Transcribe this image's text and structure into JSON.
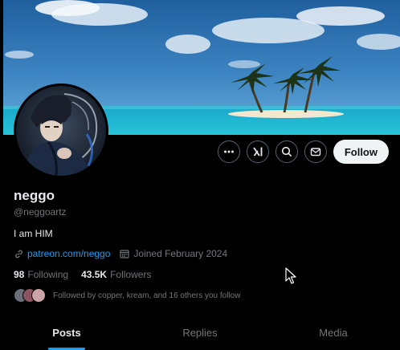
{
  "profile": {
    "display_name": "neggo",
    "handle": "@neggoartz",
    "bio": "I am HIM",
    "link": "patreon.com/neggo",
    "joined": "Joined February 2024",
    "following_count": "98",
    "following_label": "Following",
    "followers_count": "43.5K",
    "followers_label": "Followers",
    "followed_by": "Followed by copper, kream, and 16 others you follow"
  },
  "actions": {
    "more_icon": "more-icon",
    "grok_icon": "grok-icon",
    "search_icon": "search-icon",
    "message_icon": "mail-icon",
    "follow_label": "Follow"
  },
  "tabs": [
    {
      "label": "Posts",
      "active": true
    },
    {
      "label": "Replies",
      "active": false
    },
    {
      "label": "Media",
      "active": false
    }
  ],
  "colors": {
    "accent": "#1d9bf0",
    "background": "#000000",
    "muted": "#71767b",
    "text": "#e7e9ea"
  }
}
